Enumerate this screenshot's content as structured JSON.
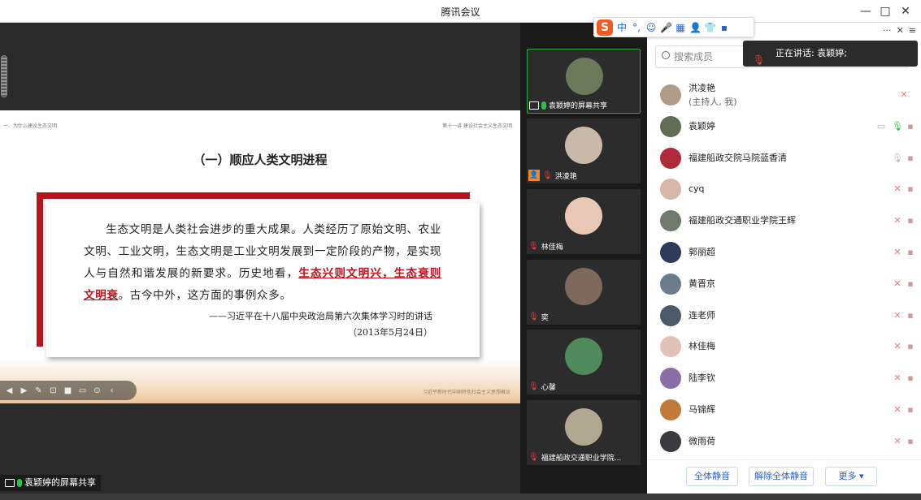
{
  "window": {
    "title": "腾讯会议",
    "minimize": "—",
    "maximize": "□",
    "close": "✕"
  },
  "slide": {
    "top_left": "一、为什么建设生态文明",
    "top_right": "第十一讲 建设社会主义生态文明",
    "heading": "（一）顺应人类文明进程",
    "quote_part1": "生态文明是人类社会进步的重大成果。人类经历了原始文明、农业文明、工业文明，生态文明是工业文明发展到一定阶段的产物，是实现人与自然和谐发展的新要求。历史地看，",
    "quote_highlight": "生态兴则文明兴，生态衰则文明衰",
    "quote_part2": "。古今中外，这方面的事例众多。",
    "source_line1": "——习近平在十八届中央政治局第六次集体学习时的讲话",
    "source_line2": "（2013年5月24日）",
    "footer": "习近平新时代中国特色社会主义思想概论"
  },
  "share_label": "袁颖婷的屏幕共享",
  "ime": {
    "logo": "S",
    "buttons": [
      "中",
      "°,",
      "☺",
      "🎤",
      "▦",
      "👤",
      "👕",
      "▪"
    ]
  },
  "video_tiles": [
    {
      "label": "袁颖婷的屏幕共享",
      "avatar_color": "#6a7a5a"
    },
    {
      "label": "洪凌艳",
      "avatar_color": "#c9b9a8"
    },
    {
      "label": "林佳梅",
      "avatar_color": "#e8c7b5"
    },
    {
      "label": "奕",
      "avatar_color": "#7d6a5c"
    },
    {
      "label": "心馨",
      "avatar_color": "#4f8a5d"
    },
    {
      "label": "福建船政交通职业学院...",
      "avatar_color": "#b0a890"
    }
  ],
  "panel": {
    "top_more": "···",
    "top_close": "✕",
    "top_menu": "≡",
    "search_placeholder": "搜索成员",
    "speaking": "正在讲话: 袁颖婷;",
    "members": [
      {
        "name": "洪凌艳",
        "role": "(主持人, 我)",
        "avatar_color": "#b09a88",
        "mic": "off"
      },
      {
        "name": "袁颖婷",
        "avatar_color": "#5f6e55",
        "mic": "on"
      },
      {
        "name": "福建船政交院马院蓝香清",
        "avatar_color": "#b02a3a",
        "mic": "idle"
      },
      {
        "name": "cyq",
        "avatar_color": "#d9b7a6",
        "mic": "off"
      },
      {
        "name": "福建船政交通职业学院王辉",
        "avatar_color": "#6f7a6c",
        "mic": "off"
      },
      {
        "name": "郭丽超",
        "avatar_color": "#2e3a5a",
        "mic": "off"
      },
      {
        "name": "黄晋京",
        "avatar_color": "#6b7c8c",
        "mic": "off"
      },
      {
        "name": "连老师",
        "avatar_color": "#4a5a6a",
        "mic": "off"
      },
      {
        "name": "林佳梅",
        "avatar_color": "#e2c2b8",
        "mic": "off"
      },
      {
        "name": "陆李钦",
        "avatar_color": "#8a6ea8",
        "mic": "off"
      },
      {
        "name": "马锦辉",
        "avatar_color": "#c27a3a",
        "mic": "off"
      },
      {
        "name": "微雨荷",
        "avatar_color": "#3a3a40",
        "mic": "off"
      }
    ],
    "footer": {
      "mute_all": "全体静音",
      "unmute_all": "解除全体静音",
      "more": "更多 ▾"
    }
  }
}
